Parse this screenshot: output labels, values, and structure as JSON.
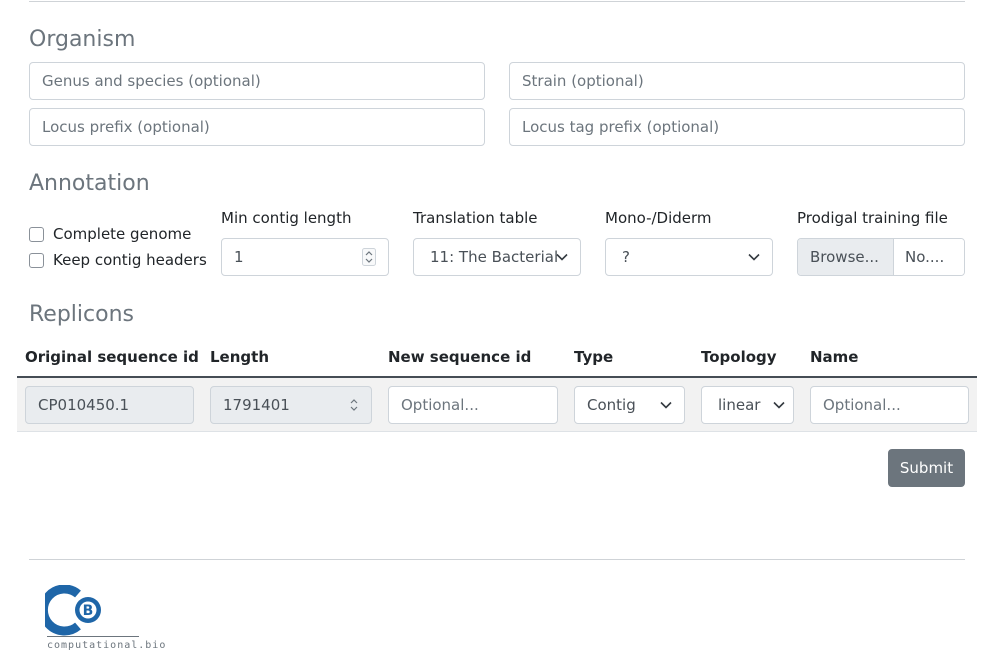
{
  "organism": {
    "heading": "Organism",
    "genus_placeholder": "Genus and species (optional)",
    "strain_placeholder": "Strain (optional)",
    "locus_placeholder": "Locus prefix (optional)",
    "locus_tag_placeholder": "Locus tag prefix (optional)"
  },
  "annotation": {
    "heading": "Annotation",
    "complete_genome_label": "Complete genome",
    "keep_headers_label": "Keep contig headers",
    "min_contig_label": "Min contig length",
    "min_contig_value": "1",
    "translation_label": "Translation table",
    "translation_value": "11: The Bacterial",
    "dermtype_label": "Mono-/Diderm",
    "dermtype_value": "?",
    "prodigal_label": "Prodigal training file",
    "browse_label": "Browse...",
    "file_status": "No...."
  },
  "replicons": {
    "heading": "Replicons",
    "columns": [
      "Original sequence id",
      "Length",
      "New sequence id",
      "Type",
      "Topology",
      "Name"
    ],
    "rows": [
      {
        "original_id": "CP010450.1",
        "length": "1791401",
        "new_id_placeholder": "Optional...",
        "type": "Contig",
        "topology": "linear",
        "name_placeholder": "Optional..."
      }
    ]
  },
  "actions": {
    "submit_label": "Submit"
  },
  "footer": {
    "logo_text": "computational.bio"
  },
  "colors": {
    "logo_blue": "#1f66a8",
    "submit_bg": "#6c757d",
    "heading_gray": "#6c757d"
  }
}
